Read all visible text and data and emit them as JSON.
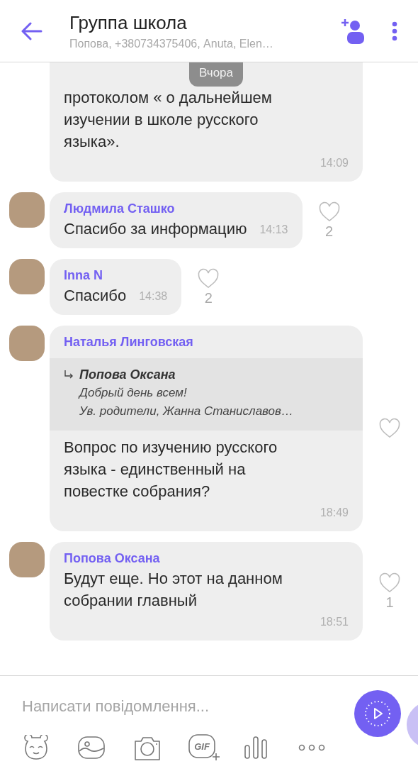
{
  "header": {
    "title": "Группа школа",
    "subtitle": "Попова, +380734375406, Anuta, Elen…"
  },
  "date_pill": "Вчора",
  "messages": [
    {
      "kind": "block",
      "continued": true,
      "text": "протоколом « о дальнейшем\nизучении  в школе русского\nязыка».",
      "time": "14:09"
    },
    {
      "kind": "inline",
      "sender": "Людмила Сташко",
      "text": "Спасибо за информацию",
      "time": "14:13",
      "reaction": {
        "liked": false,
        "count": "2"
      }
    },
    {
      "kind": "inline",
      "sender": "Inna N",
      "text": "Спасибо",
      "time": "14:38",
      "reaction": {
        "liked": false,
        "count": "2"
      }
    },
    {
      "kind": "block",
      "sender": "Наталья Линговская",
      "reply": {
        "author": "Попова Оксана",
        "text": "Добрый день всем!\nУв. родители, Жанна Станиславов…"
      },
      "text": "Вопрос по изучению русского\nязыка - единственный на\nповестке собрания?",
      "time": "18:49",
      "reaction": {
        "liked": false
      }
    },
    {
      "kind": "block",
      "sender": "Попова Оксана",
      "text": "Будут еще. Но этот на данном\nсобрании главный",
      "time": "18:51",
      "reaction": {
        "liked": false,
        "count": "1"
      }
    }
  ],
  "composer": {
    "placeholder": "Написати повідомлення...",
    "tools": [
      {
        "kind": "sticker"
      },
      {
        "kind": "gallery"
      },
      {
        "kind": "camera"
      },
      {
        "kind": "gif",
        "label": "GIF"
      },
      {
        "kind": "voice"
      },
      {
        "kind": "more"
      }
    ]
  }
}
